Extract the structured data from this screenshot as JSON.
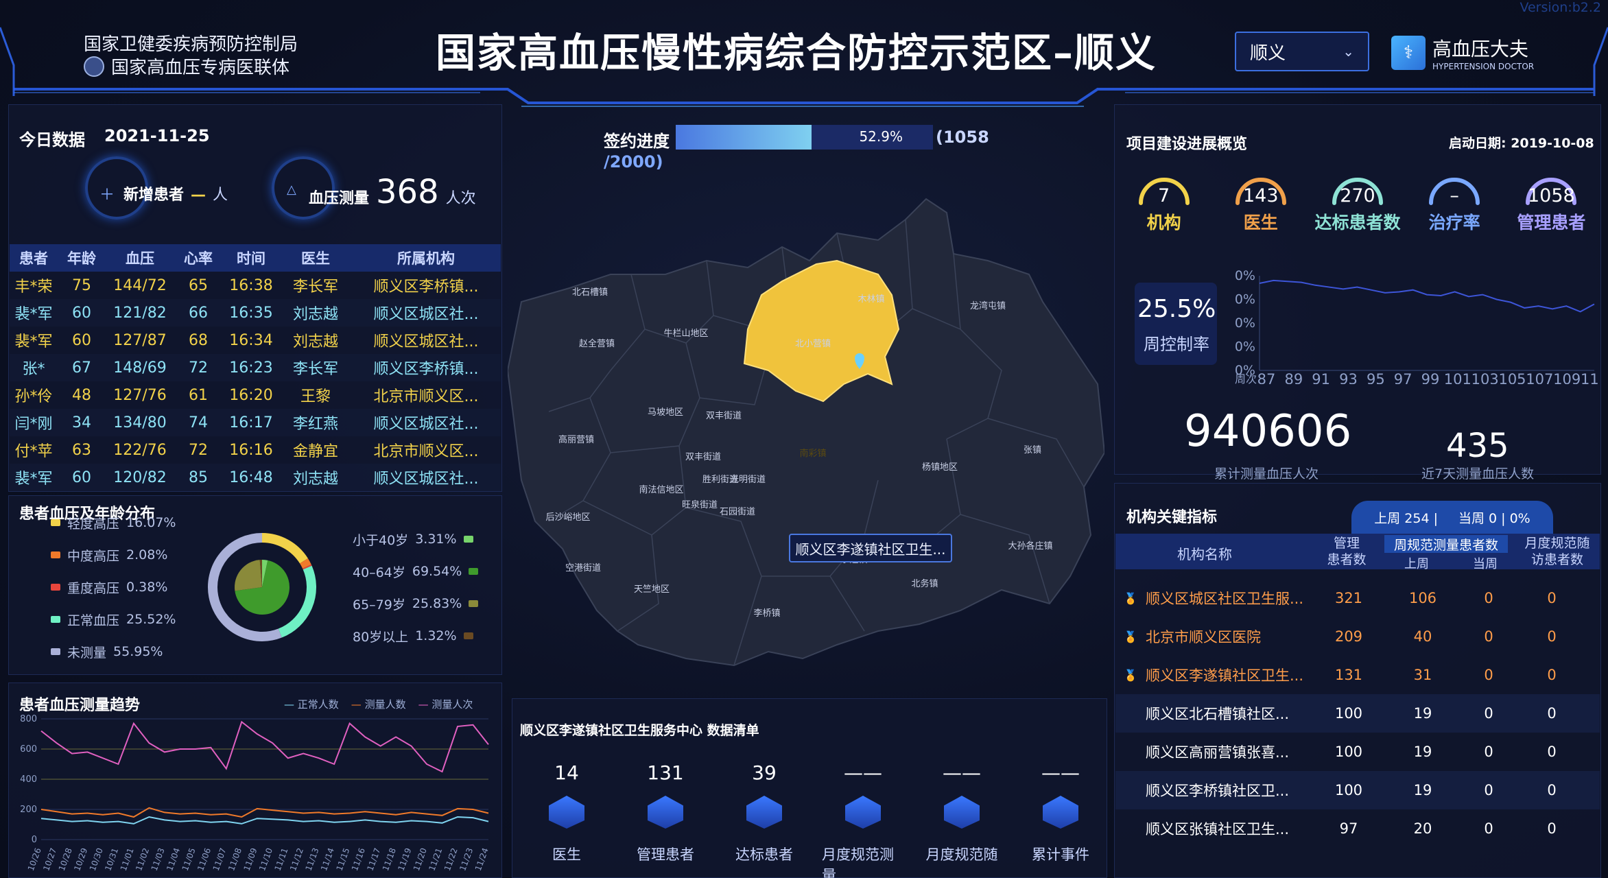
{
  "header": {
    "org_line1": "国家卫健委疾病预防控制局",
    "org_line2": "国家高血压专病医联体",
    "title": "国家高血压慢性病综合防控示范区–顺义",
    "region_select": "顺义",
    "brand_cn": "高血压大夫",
    "brand_en": "HYPERTENSION DOCTOR",
    "version": "Version:b2.2"
  },
  "today": {
    "title": "今日数据",
    "date": "2021-11-25",
    "new_patients_label": "新增患者",
    "new_patients_value": "—",
    "new_patients_unit": "人",
    "bp_label": "血压测量",
    "bp_value": "368",
    "bp_unit": "人次"
  },
  "patients_table": {
    "headers": [
      "患者",
      "年龄",
      "血压",
      "心率",
      "时间",
      "医生",
      "所属机构"
    ],
    "rows": [
      [
        "丰*荣",
        "75",
        "144/72",
        "65",
        "16:38",
        "李长军",
        "顺义区李桥镇..."
      ],
      [
        "裴*军",
        "60",
        "121/82",
        "66",
        "16:35",
        "刘志越",
        "顺义区城区社..."
      ],
      [
        "裴*军",
        "60",
        "127/87",
        "68",
        "16:34",
        "刘志越",
        "顺义区城区社..."
      ],
      [
        "张*",
        "67",
        "148/69",
        "72",
        "16:23",
        "李长军",
        "顺义区李桥镇..."
      ],
      [
        "孙*伶",
        "48",
        "127/76",
        "61",
        "16:20",
        "王黎",
        "北京市顺义区..."
      ],
      [
        "闫*刚",
        "34",
        "134/80",
        "74",
        "16:17",
        "李红燕",
        "顺义区城区社..."
      ],
      [
        "付*苹",
        "63",
        "122/76",
        "72",
        "16:16",
        "金静宜",
        "北京市顺义区..."
      ],
      [
        "裴*军",
        "60",
        "120/82",
        "85",
        "16:48",
        "刘志越",
        "顺义区城区社..."
      ]
    ]
  },
  "distribution": {
    "title": "患者血压及年龄分布",
    "bp": [
      {
        "label": "轻度高压",
        "value": "16.07%",
        "color": "#f2d24a"
      },
      {
        "label": "中度高压",
        "value": "2.08%",
        "color": "#f07a2a"
      },
      {
        "label": "重度高压",
        "value": "0.38%",
        "color": "#e8453c"
      },
      {
        "label": "正常血压",
        "value": "25.52%",
        "color": "#6ff0c4"
      },
      {
        "label": "未测量",
        "value": "55.95%",
        "color": "#aab0d8"
      }
    ],
    "age": [
      {
        "label": "小于40岁",
        "value": "3.31%",
        "color": "#77d46b"
      },
      {
        "label": "40–64岁",
        "value": "69.54%",
        "color": "#3f9b2c"
      },
      {
        "label": "65–79岁",
        "value": "25.83%",
        "color": "#8a8a3a"
      },
      {
        "label": "80岁以上",
        "value": "1.32%",
        "color": "#6a4a22"
      }
    ]
  },
  "trend": {
    "title": "患者血压测量趋势",
    "legend": [
      "正常人数",
      "测量人数",
      "测量人次"
    ]
  },
  "sign": {
    "label": "签约进度",
    "percent": "52.9%",
    "suffix": "(1058",
    "suffix2": "/2000)"
  },
  "map": {
    "districts": [
      "北石槽镇",
      "木林镇",
      "龙湾屯镇",
      "赵全营镇",
      "牛栏山地区",
      "北小营镇",
      "马坡地区",
      "双丰街道",
      "高丽营镇",
      "南彩镇",
      "杨镇地区",
      "张镇",
      "双丰街道",
      "胜利街道",
      "光明街道",
      "南法信地区",
      "旺泉街道",
      "石园街道",
      "后沙峪地区",
      "李遂镇",
      "北务镇",
      "大孙各庄镇",
      "空港街道",
      "天竺地区",
      "李桥镇"
    ],
    "tooltip": "顺义区李遂镇社区卫生..."
  },
  "list": {
    "title": "顺义区李遂镇社区卫生服务中心 数据清单",
    "items": [
      {
        "value": "14",
        "label": "医生",
        "icon": "doctor-icon"
      },
      {
        "value": "131",
        "label": "管理患者",
        "icon": "record-icon"
      },
      {
        "value": "39",
        "label": "达标患者",
        "icon": "user-check-icon"
      },
      {
        "value": "——",
        "label": "月度规范测量",
        "icon": "calendar-icon"
      },
      {
        "value": "——",
        "label": "月度规范随",
        "icon": "medical-kit-icon"
      },
      {
        "value": "——",
        "label": "累计事件",
        "icon": "warning-icon"
      }
    ]
  },
  "project": {
    "title": "项目建设进展概览",
    "start_label": "启动日期: 2019-10-08",
    "gauges": [
      {
        "value": "7",
        "label": "机构",
        "color": "#f2d24a"
      },
      {
        "value": "143",
        "label": "医生",
        "color": "#f0a04a"
      },
      {
        "value": "270",
        "label": "达标患者数",
        "color": "#8ee2d5"
      },
      {
        "value": "–",
        "label": "治疗率",
        "color": "#7aa8ff"
      },
      {
        "value": "1058",
        "label": "管理患者",
        "color": "#a8a0ff"
      }
    ],
    "weekly_rate": "25.5%",
    "weekly_label": "周控制率",
    "y_ticks": [
      "0%",
      "0%",
      "0%",
      "0%",
      "0%"
    ],
    "x_label": "周次",
    "x_ticks": [
      "87",
      "89",
      "91",
      "93",
      "95",
      "97",
      "99",
      "101",
      "103",
      "105",
      "107",
      "109",
      "111"
    ],
    "total_value": "940606",
    "total_label": "累计测量血压人次",
    "week_value": "435",
    "week_label": "近7天测量血压人数"
  },
  "kpi": {
    "title": "机构关键指标",
    "tab1": "上周 254 |",
    "tab2": "当周 0 | 0%",
    "headers": {
      "name": "机构名称",
      "manage": "管理",
      "manage2": "患者数",
      "weekly": "周规范测量患者数",
      "last": "上周",
      "cur": "当周",
      "monthly": "月度规范随",
      "monthly2": "访患者数"
    },
    "rows": [
      {
        "name": "顺义区城区社区卫生服...",
        "manage": "321",
        "last": "106",
        "cur": "0",
        "month": "0",
        "hl": true
      },
      {
        "name": "北京市顺义区医院",
        "manage": "209",
        "last": "40",
        "cur": "0",
        "month": "0",
        "hl": true
      },
      {
        "name": "顺义区李遂镇社区卫生...",
        "manage": "131",
        "last": "31",
        "cur": "0",
        "month": "0",
        "hl": true
      },
      {
        "name": "顺义区北石槽镇社区...",
        "manage": "100",
        "last": "19",
        "cur": "0",
        "month": "0",
        "hl": false
      },
      {
        "name": "顺义区高丽营镇张喜...",
        "manage": "100",
        "last": "19",
        "cur": "0",
        "month": "0",
        "hl": false
      },
      {
        "name": "顺义区李桥镇社区卫...",
        "manage": "100",
        "last": "19",
        "cur": "0",
        "month": "0",
        "hl": false
      },
      {
        "name": "顺义区张镇社区卫生...",
        "manage": "97",
        "last": "20",
        "cur": "0",
        "month": "0",
        "hl": false
      }
    ]
  },
  "chart_data": [
    {
      "type": "line",
      "title": "患者血压测量趋势",
      "x": [
        "10/26",
        "10/27",
        "10/28",
        "10/29",
        "10/30",
        "10/31",
        "11/01",
        "11/02",
        "11/03",
        "11/04",
        "11/05",
        "11/06",
        "11/07",
        "11/08",
        "11/09",
        "11/10",
        "11/11",
        "11/12",
        "11/13",
        "11/14",
        "11/15",
        "11/16",
        "11/17",
        "11/18",
        "11/19",
        "11/20",
        "11/21",
        "11/22",
        "11/23",
        "11/24"
      ],
      "ylim": [
        0,
        800
      ],
      "yticks": [
        0,
        200,
        400,
        600,
        800
      ],
      "series": [
        {
          "name": "正常人数",
          "color": "#7fd4f0",
          "values": [
            140,
            130,
            120,
            125,
            115,
            120,
            105,
            150,
            130,
            120,
            125,
            115,
            120,
            105,
            140,
            135,
            130,
            120,
            125,
            115,
            120,
            130,
            120,
            115,
            125,
            120,
            110,
            150,
            145,
            120
          ]
        },
        {
          "name": "测量人数",
          "color": "#f07a2a",
          "values": [
            200,
            185,
            170,
            175,
            165,
            175,
            150,
            210,
            180,
            170,
            175,
            165,
            170,
            150,
            205,
            195,
            185,
            175,
            180,
            170,
            175,
            185,
            175,
            165,
            180,
            170,
            160,
            205,
            200,
            175
          ]
        },
        {
          "name": "测量人次",
          "color": "#e060c0",
          "values": [
            720,
            640,
            570,
            580,
            540,
            500,
            770,
            640,
            580,
            600,
            600,
            610,
            470,
            780,
            700,
            640,
            540,
            570,
            540,
            500,
            770,
            680,
            620,
            680,
            620,
            500,
            450,
            750,
            760,
            630
          ]
        }
      ]
    },
    {
      "type": "line",
      "title": "周控制率",
      "x": [
        "87",
        "88",
        "89",
        "90",
        "91",
        "92",
        "93",
        "94",
        "95",
        "96",
        "97",
        "98",
        "99",
        "100",
        "101",
        "102",
        "103",
        "104",
        "105",
        "106",
        "107",
        "108",
        "109",
        "110",
        "111"
      ],
      "ylabel": "",
      "values_note": "",
      "series": [
        {
          "values": [
            0.92,
            0.95,
            0.94,
            0.93,
            0.9,
            0.88,
            0.86,
            0.88,
            0.85,
            0.82,
            0.83,
            0.85,
            0.8,
            0.79,
            0.83,
            0.78,
            0.8,
            0.75,
            0.72,
            0.66,
            0.68,
            0.65,
            0.68,
            0.62,
            0.7
          ]
        }
      ],
      "ylim": [
        0,
        1
      ]
    }
  ]
}
